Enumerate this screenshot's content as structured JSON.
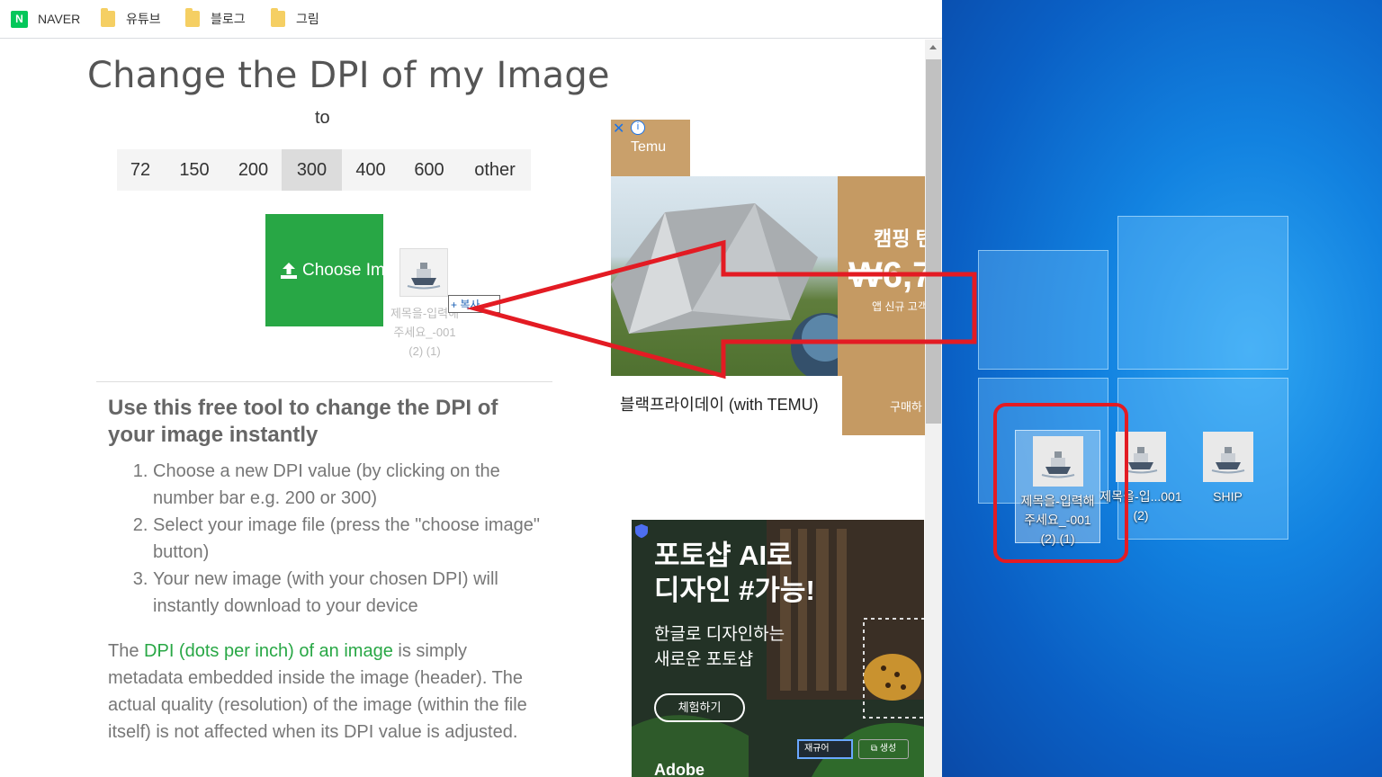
{
  "bookmarks": [
    {
      "label": "NAVER",
      "icon": "naver-logo"
    },
    {
      "label": "유튜브",
      "icon": "folder-icon"
    },
    {
      "label": "블로그",
      "icon": "folder-icon"
    },
    {
      "label": "그림",
      "icon": "folder-icon"
    }
  ],
  "page": {
    "title": "Change the DPI of my Image",
    "to_label": "to",
    "dpi_options": [
      "72",
      "150",
      "200",
      "300",
      "400",
      "600",
      "other"
    ],
    "dpi_selected": "300",
    "choose_button": "Choose Im",
    "drag_ghost": {
      "copy_label": "+ 복사",
      "file_label": "제목을-입력해주세요_-001 (2) (1)"
    },
    "subheading": "Use this free tool to change the DPI of your image instantly",
    "steps": [
      "Choose a new DPI value (by clicking on the number bar e.g. 200 or 300)",
      "Select your image file (press the \"choose image\" button)",
      "Your new image (with your chosen DPI) will instantly download to your device"
    ],
    "paragraph": {
      "pre": "The ",
      "link": "DPI (dots per inch) of an image",
      "post": " is simply metadata embedded inside the image (header). The actual quality (resolution) of the image (within the file itself) is not affected when its DPI value is adjusted."
    }
  },
  "ads": {
    "temu": {
      "brand": "Temu",
      "close": "✕",
      "info": "i",
      "headline": "캠핑 텐",
      "price": "₩6,7",
      "subtext": "앱 신규 고객",
      "caption": "블랙프라이데이 (with TEMU)",
      "buy": "구매하"
    },
    "adobe": {
      "headline_1": "포토샵 AI로",
      "headline_2": "디자인 #가능!",
      "sub_1": "한글로 디자인하는",
      "sub_2": "새로운 포토샵",
      "try": "체험하기",
      "field": "재규어",
      "generate": "⧉ 생성",
      "brand": "Adobe"
    }
  },
  "desktop": {
    "icons": [
      {
        "label": "제목을-입력해주세요_-001 (2) (1)",
        "selected": true
      },
      {
        "label": "제목을-입...001 (2)",
        "selected": false
      },
      {
        "label": "SHIP",
        "selected": false
      }
    ]
  },
  "colors": {
    "accent_green": "#28a745",
    "annotation_red": "#e31b23",
    "desktop_blue": "#1282e0"
  }
}
